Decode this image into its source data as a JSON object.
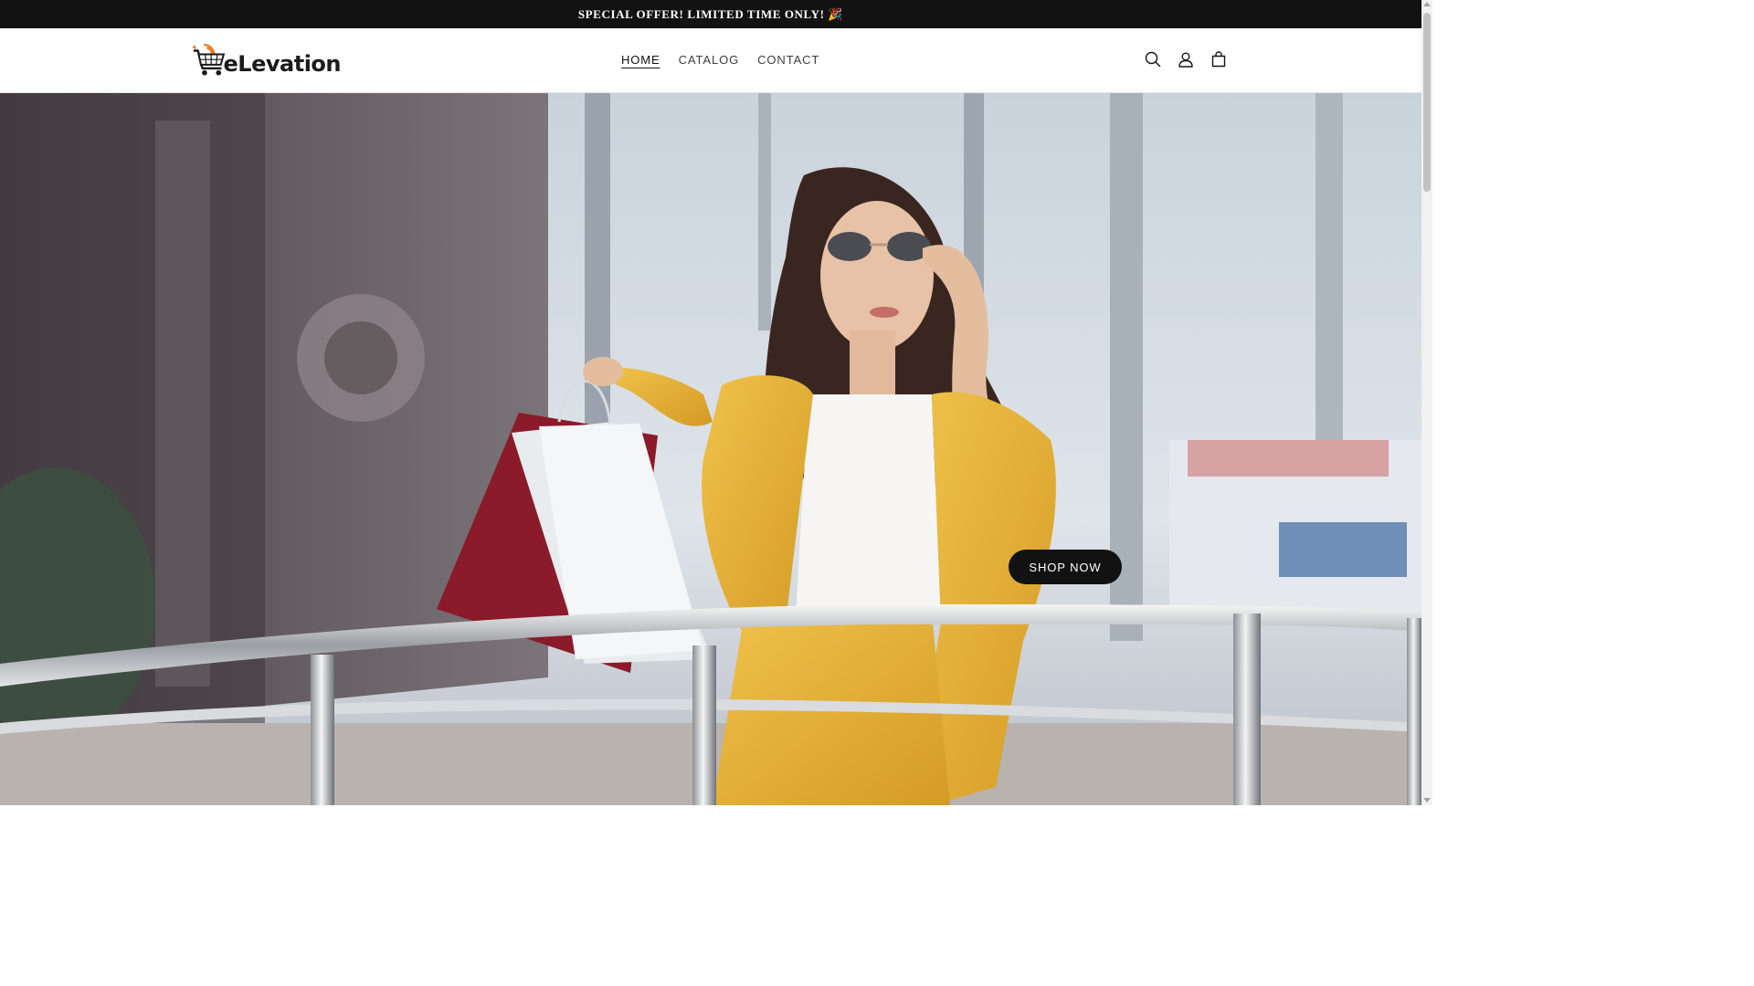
{
  "announcement": {
    "text": "SPECIAL OFFER! LIMITED TIME ONLY! 🎉"
  },
  "logo": {
    "text": "eLevation",
    "icon": "shopping-cart-logo"
  },
  "nav": {
    "items": [
      {
        "label": "HOME",
        "active": true
      },
      {
        "label": "CATALOG",
        "active": false
      },
      {
        "label": "CONTACT",
        "active": false
      }
    ]
  },
  "header_icons": [
    "search-icon",
    "account-icon",
    "cart-icon"
  ],
  "hero": {
    "image": "woman in yellow suit holding shopping bags",
    "cta_label": "SHOP NOW"
  },
  "colors": {
    "announcement_bg": "#121212",
    "button_bg": "#121212",
    "text": "#121212",
    "logo_accent": "#e8802a",
    "suit_yellow": "#e6b43a"
  }
}
